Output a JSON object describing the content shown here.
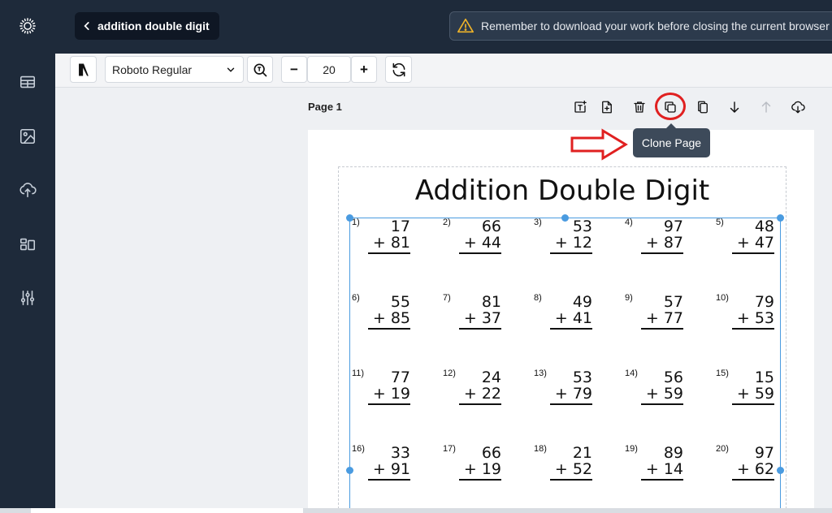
{
  "app": {
    "back_label": "addition double digit",
    "notice": "Remember to download your work before closing the current browser s"
  },
  "sidebar": {
    "icons": [
      "logo-icon",
      "table-icon",
      "image-icon",
      "upload-icon",
      "layout-icon",
      "sliders-icon"
    ]
  },
  "toolbar": {
    "font": "Roboto Regular",
    "minus": "−",
    "size": "20",
    "plus": "+"
  },
  "page": {
    "label": "Page 1",
    "tooltip": "Clone Page",
    "icons": [
      "add-text-icon",
      "add-page-icon",
      "delete-page-icon",
      "clone-page-icon",
      "copy-page-icon",
      "move-down-icon",
      "move-up-icon",
      "download-page-icon"
    ]
  },
  "worksheet": {
    "title": "Addition Double Digit",
    "problems": [
      {
        "n": "1)",
        "a": "17",
        "b": "+ 81"
      },
      {
        "n": "2)",
        "a": "66",
        "b": "+ 44"
      },
      {
        "n": "3)",
        "a": "53",
        "b": "+ 12"
      },
      {
        "n": "4)",
        "a": "97",
        "b": "+ 87"
      },
      {
        "n": "5)",
        "a": "48",
        "b": "+ 47"
      },
      {
        "n": "6)",
        "a": "55",
        "b": "+ 85"
      },
      {
        "n": "7)",
        "a": "81",
        "b": "+ 37"
      },
      {
        "n": "8)",
        "a": "49",
        "b": "+ 41"
      },
      {
        "n": "9)",
        "a": "57",
        "b": "+ 77"
      },
      {
        "n": "10)",
        "a": "79",
        "b": "+ 53"
      },
      {
        "n": "11)",
        "a": "77",
        "b": "+ 19"
      },
      {
        "n": "12)",
        "a": "24",
        "b": "+ 22"
      },
      {
        "n": "13)",
        "a": "53",
        "b": "+ 79"
      },
      {
        "n": "14)",
        "a": "56",
        "b": "+ 59"
      },
      {
        "n": "15)",
        "a": "15",
        "b": "+ 59"
      },
      {
        "n": "16)",
        "a": "33",
        "b": "+ 91"
      },
      {
        "n": "17)",
        "a": "66",
        "b": "+ 19"
      },
      {
        "n": "18)",
        "a": "21",
        "b": "+ 52"
      },
      {
        "n": "19)",
        "a": "89",
        "b": "+ 14"
      },
      {
        "n": "20)",
        "a": "97",
        "b": "+ 62"
      }
    ]
  },
  "colors": {
    "sidebar": "#1e2a3a",
    "selection": "#4a9be0",
    "highlight": "#e02020"
  }
}
